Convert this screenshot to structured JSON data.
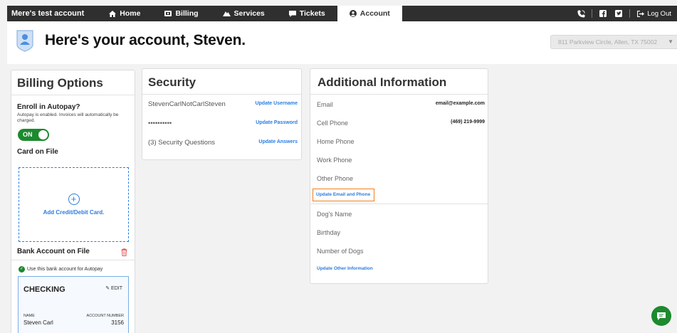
{
  "nav": {
    "brand": "Mere's test account",
    "items": [
      {
        "label": "Home",
        "icon": "home-icon",
        "active": false
      },
      {
        "label": "Billing",
        "icon": "billing-icon",
        "active": false
      },
      {
        "label": "Services",
        "icon": "services-icon",
        "active": false
      },
      {
        "label": "Tickets",
        "icon": "tickets-icon",
        "active": false
      },
      {
        "label": "Account",
        "icon": "account-icon",
        "active": true
      }
    ],
    "logout": "Log Out"
  },
  "header": {
    "title": "Here's your account, Steven.",
    "address": "811 Parkview Circle, Allen, TX 75002"
  },
  "billing": {
    "title": "Billing Options",
    "enroll_title": "Enroll in Autopay?",
    "enroll_desc": "Autopay is enabled. Invoices will automatically be charged.",
    "toggle_label": "ON",
    "card_on_file": "Card on File",
    "add_card": "Add Credit/Debit Card.",
    "bank_title": "Bank Account on File",
    "use_bank": "Use this bank account for Autopay",
    "account": {
      "type": "CHECKING",
      "edit": "EDIT",
      "name_label": "NAME",
      "name": "Steven Carl",
      "number_label": "ACCOUNT NUMBER",
      "number": "3156"
    }
  },
  "security": {
    "title": "Security",
    "rows": [
      {
        "value": "StevenCarlNotCarlSteven",
        "link": "Update Username"
      },
      {
        "value": "••••••••••",
        "link": "Update Password"
      },
      {
        "value": "(3) Security Questions",
        "link": "Update Answers"
      }
    ]
  },
  "additional": {
    "title": "Additional Information",
    "rows": [
      {
        "label": "Email",
        "value": "email@example.com"
      },
      {
        "label": "Cell Phone",
        "value": "(469) 219-9999"
      },
      {
        "label": "Home Phone",
        "value": ""
      },
      {
        "label": "Work Phone",
        "value": ""
      },
      {
        "label": "Other Phone",
        "value": ""
      }
    ],
    "update_email_phone": "Update Email and Phone",
    "rows2": [
      {
        "label": "Dog's Name"
      },
      {
        "label": "Birthday"
      },
      {
        "label": "Number of Dogs"
      }
    ],
    "update_other": "Update Other Information"
  },
  "colors": {
    "nav_bg": "#2f2f2f",
    "link": "#2a7de1",
    "success": "#1c8a2e",
    "highlight": "#f07f1d"
  }
}
